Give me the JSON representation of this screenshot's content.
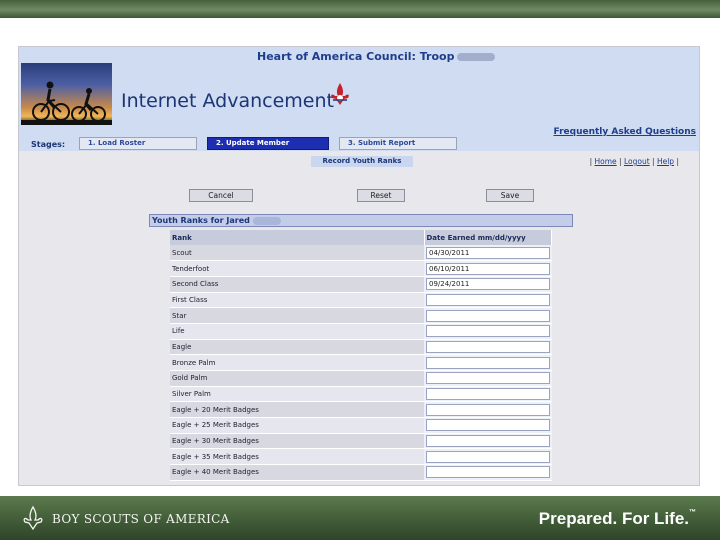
{
  "slide": {
    "brand_text": "BOY SCOUTS OF AMERICA",
    "tagline": "Prepared. For Life.",
    "tagline_mark": "™"
  },
  "header": {
    "council": "Heart of America Council: Troop",
    "app_title": "Internet Advancement"
  },
  "stages": {
    "label": "Stages:",
    "items": [
      {
        "label": "1. Load Roster",
        "active": false
      },
      {
        "label": "2. Update Member",
        "active": true
      },
      {
        "label": "3. Submit Report",
        "active": false
      }
    ]
  },
  "faq_link": "Frequently Asked Questions",
  "subtab": "Record Youth Ranks",
  "nav_links": {
    "sep": "|",
    "home": "Home",
    "logout": "Logout",
    "help": "Help"
  },
  "buttons": {
    "cancel": "Cancel",
    "reset": "Reset",
    "save": "Save"
  },
  "panel_title": "Youth Ranks for Jared",
  "table": {
    "headers": {
      "rank": "Rank",
      "date": "Date Earned mm/dd/yyyy"
    },
    "rows": [
      {
        "rank": "Scout",
        "date": "04/30/2011"
      },
      {
        "rank": "Tenderfoot",
        "date": "06/10/2011"
      },
      {
        "rank": "Second Class",
        "date": "09/24/2011"
      },
      {
        "rank": "First Class",
        "date": ""
      },
      {
        "rank": "Star",
        "date": ""
      },
      {
        "rank": "Life",
        "date": ""
      },
      {
        "rank": "Eagle",
        "date": ""
      },
      {
        "rank": "Bronze Palm",
        "date": ""
      },
      {
        "rank": "Gold Palm",
        "date": ""
      },
      {
        "rank": "Silver Palm",
        "date": ""
      },
      {
        "rank": "Eagle + 20 Merit Badges",
        "date": ""
      },
      {
        "rank": "Eagle + 25 Merit Badges",
        "date": ""
      },
      {
        "rank": "Eagle + 30 Merit Badges",
        "date": ""
      },
      {
        "rank": "Eagle + 35 Merit Badges",
        "date": ""
      },
      {
        "rank": "Eagle + 40 Merit Badges",
        "date": ""
      }
    ]
  },
  "colors": {
    "header_bg": "#cfdcf2",
    "active_stage": "#1d2fb0",
    "slide_band": "#4f6b45"
  }
}
